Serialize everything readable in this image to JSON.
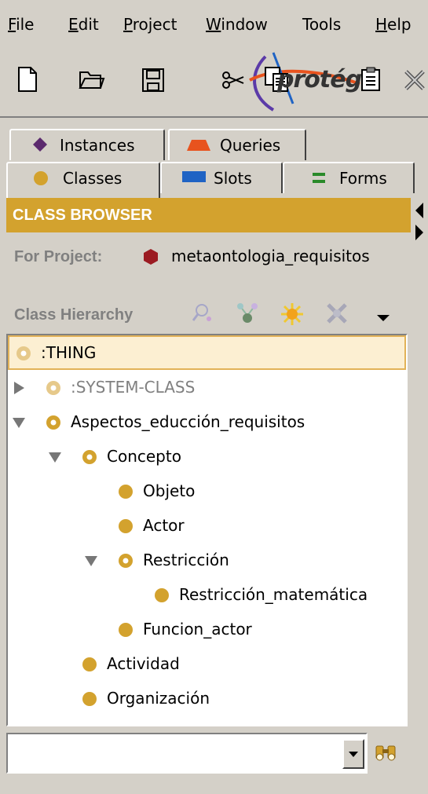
{
  "menu": [
    {
      "label": "File",
      "mnemonic": "F",
      "rest": "ile"
    },
    {
      "label": "Edit",
      "mnemonic": "E",
      "rest": "dit"
    },
    {
      "label": "Project",
      "mnemonic": "P",
      "rest": "roject"
    },
    {
      "label": "Window",
      "mnemonic": "W",
      "rest": "indow"
    },
    {
      "label": "Tools",
      "mnemonic": "",
      "rest": "Tools"
    },
    {
      "label": "Help",
      "mnemonic": "H",
      "rest": "elp"
    }
  ],
  "toolbar": {
    "icons": [
      "new-file-icon",
      "open-folder-icon",
      "save-icon",
      "cut-icon",
      "copy-icon",
      "paste-icon",
      "close-icon"
    ],
    "logo_text": "protégé"
  },
  "tabs": {
    "row1": [
      {
        "label": "Instances",
        "icon": "diamond-icon",
        "color": "#5b2a6e"
      },
      {
        "label": "Queries",
        "icon": "triangle-icon",
        "color": "#e8531e"
      }
    ],
    "row2": [
      {
        "label": "Classes",
        "icon": "circle-icon",
        "color": "#d3a22e",
        "active": true
      },
      {
        "label": "Slots",
        "icon": "rect-icon",
        "color": "#1f63c4"
      },
      {
        "label": "Forms",
        "icon": "lines-icon",
        "color": "#2a8a2a"
      }
    ]
  },
  "class_browser": {
    "header": "CLASS BROWSER",
    "for_project_label": "For Project:",
    "project_name": "metaontologia_requisitos",
    "hierarchy_label": "Class Hierarchy",
    "hierarchy_tools": [
      "search-class-icon",
      "create-subclass-icon",
      "create-class-icon",
      "delete-class-icon",
      "menu-arrow-icon"
    ]
  },
  "tree": [
    {
      "label": ":THING",
      "level": 0,
      "expander": "none",
      "icon": "abstract-light",
      "selected": true
    },
    {
      "label": ":SYSTEM-CLASS",
      "level": 1,
      "expander": "collapsed",
      "icon": "abstract-light",
      "grey": true
    },
    {
      "label": "Aspectos_educción_requisitos",
      "level": 1,
      "expander": "expanded",
      "icon": "abstract"
    },
    {
      "label": "Concepto",
      "level": 2,
      "expander": "expanded",
      "icon": "abstract"
    },
    {
      "label": "Objeto",
      "level": 3,
      "expander": "none",
      "icon": "concrete"
    },
    {
      "label": "Actor",
      "level": 3,
      "expander": "none",
      "icon": "concrete"
    },
    {
      "label": "Restricción",
      "level": 3,
      "expander": "expanded",
      "icon": "abstract"
    },
    {
      "label": "Restricción_matemática",
      "level": 4,
      "expander": "none",
      "icon": "concrete"
    },
    {
      "label": "Funcion_actor",
      "level": 3,
      "expander": "none",
      "icon": "concrete"
    },
    {
      "label": "Actividad",
      "level": 2,
      "expander": "none",
      "icon": "concrete"
    },
    {
      "label": "Organización",
      "level": 2,
      "expander": "none",
      "icon": "concrete"
    }
  ],
  "search": {
    "value": "",
    "placeholder": ""
  },
  "colors": {
    "accent": "#d3a22e",
    "background": "#d4d0c8",
    "selection": "#fcefd2"
  }
}
